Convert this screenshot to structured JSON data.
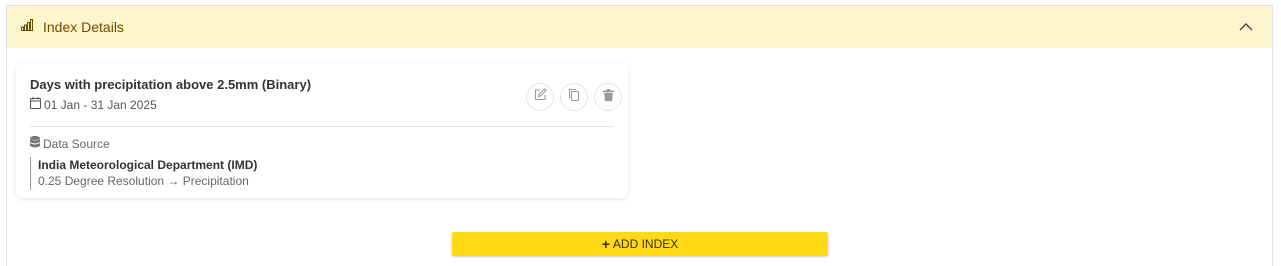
{
  "panel": {
    "title": "Index Details",
    "header_icon": "bar-chart-icon",
    "collapse_icon": "chevron-up-icon"
  },
  "index_card": {
    "title": "Days with precipitation above 2.5mm (Binary)",
    "date_range": "01 Jan - 31 Jan 2025",
    "actions": {
      "edit": "edit-icon",
      "copy": "copy-icon",
      "delete": "trash-icon"
    },
    "data_source_label": "Data Source",
    "data_source_name": "India Meteorological Department (IMD)",
    "data_source_detail": "0.25 Degree Resolution → Precipitation"
  },
  "add_button": {
    "icon": "plus-icon",
    "label": "ADD INDEX"
  },
  "colors": {
    "header_bg": "#fdf5cc",
    "accent": "#ffd915"
  }
}
